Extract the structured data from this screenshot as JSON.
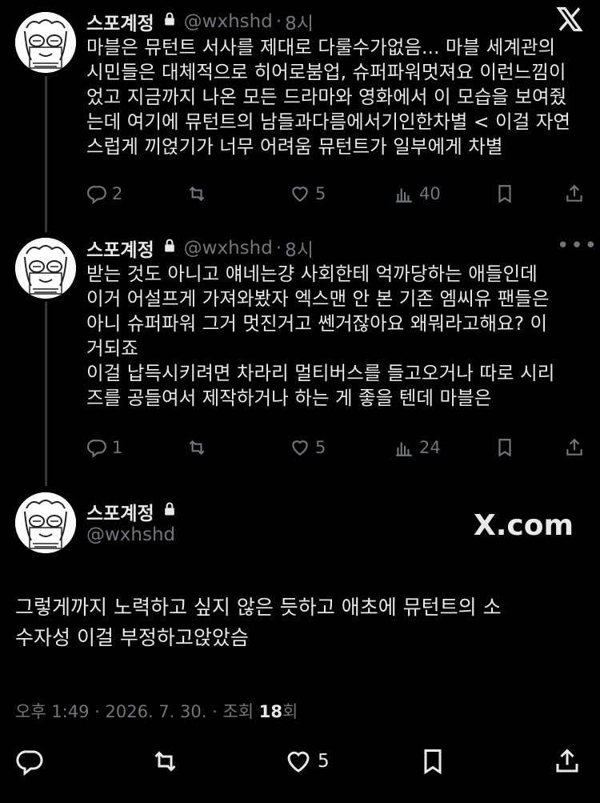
{
  "tweets": [
    {
      "name": "스포계정",
      "handle": "@wxhshd",
      "dot": "·",
      "time": "8시",
      "text": "마블은 뮤턴트 서사를 제대로 다룰수가없음... 마블 세계관의\n시민들은 대체적으로 히어로붐업, 슈퍼파워멋져요 이런느낌이\n었고 지금까지 나온 모든 드라마와 영화에서 이 모습을 보여줬\n는데 여기에 뮤턴트의 남들과다름에서기인한차별 < 이걸 자연\n스럽게 끼얹기가 너무 어려움 뮤턴트가 일부에게 차별",
      "replies": "2",
      "likes": "5",
      "views": "40"
    },
    {
      "name": "스포계정",
      "handle": "@wxhshd",
      "dot": "·",
      "time": "8시",
      "text": "받는 것도 아니고 얘네는걍 사회한테 억까당하는 애들인데\n이거 어설프게 가져와봤자 엑스맨 안 본 기존 엠씨유 팬들은\n아니 슈퍼파워 그거 멋진거고 쎈거잖아요 왜뭐라고해요? 이\n거되죠\n이걸 납득시키려면 차라리 멀티버스를 들고오거나 따로 시리\n즈를 공들여서 제작하거나 하는 게 좋을 텐데 마블은",
      "replies": "1",
      "likes": "5",
      "views": "24"
    }
  ],
  "main_tweet": {
    "name": "스포계정",
    "handle": "@wxhshd",
    "watermark": "X.com",
    "text": "그렇게까지 노력하고 싶지 않은 듯하고 애초에 뮤턴트의 소\n수자성 이걸 부정하고앉았슴",
    "timestamp": "오후 1:49 · 2026. 7. 30. · 조회 ",
    "views": "18",
    "views_suffix": "회",
    "likes": "5"
  },
  "icons": {
    "top_right": "x-logo-icon",
    "more": "more-dots-icon",
    "reply": "reply-icon",
    "retweet": "retweet-icon",
    "like": "heart-icon",
    "views": "views-icon",
    "bookmark": "bookmark-icon",
    "share": "share-icon",
    "lock": "lock-icon"
  },
  "colors": {
    "background": "#000000",
    "text": "#e7e9ea",
    "muted": "#71767b",
    "divider": "#333639"
  }
}
